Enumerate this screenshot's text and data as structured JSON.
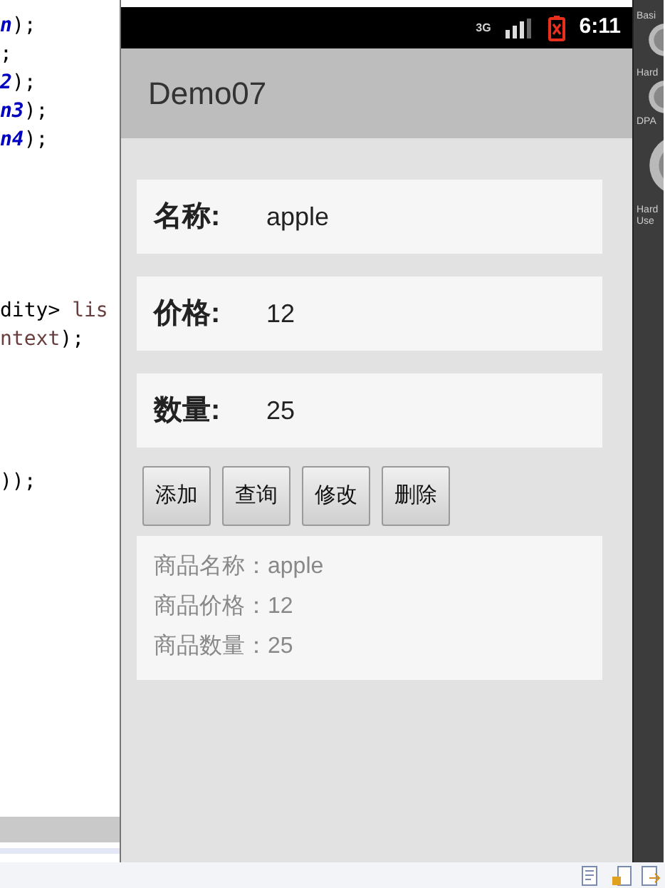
{
  "editor": {
    "lines": [
      {
        "parts": [
          {
            "text": "n",
            "kind": "field"
          },
          {
            "text": ");",
            "kind": "plain"
          }
        ]
      },
      {
        "parts": [
          {
            "text": ";",
            "kind": "plain"
          }
        ]
      },
      {
        "parts": [
          {
            "text": "2",
            "kind": "field"
          },
          {
            "text": ");",
            "kind": "plain"
          }
        ]
      },
      {
        "parts": [
          {
            "text": "n3",
            "kind": "field"
          },
          {
            "text": ");",
            "kind": "plain"
          }
        ]
      },
      {
        "parts": [
          {
            "text": "n4",
            "kind": "field"
          },
          {
            "text": ");",
            "kind": "plain"
          }
        ]
      },
      {
        "parts": [
          {
            "text": "dity> ",
            "kind": "plain"
          },
          {
            "text": "lis",
            "kind": "variable"
          }
        ]
      },
      {
        "parts": [
          {
            "text": "ntext",
            "kind": "variable"
          },
          {
            "text": ");",
            "kind": "plain"
          }
        ]
      },
      {
        "parts": [
          {
            "text": "));",
            "kind": "plain"
          }
        ]
      }
    ]
  },
  "phone": {
    "status_bar": {
      "network": "3G",
      "time": "6:11"
    },
    "app_title": "Demo07",
    "fields": [
      {
        "label": "名称:",
        "value": "apple"
      },
      {
        "label": "价格:",
        "value": "12"
      },
      {
        "label": "数量:",
        "value": "25"
      }
    ],
    "buttons": [
      "添加",
      "查询",
      "修改",
      "删除"
    ],
    "result_lines": [
      "商品名称：apple",
      "商品价格：12",
      "商品数量：25"
    ]
  },
  "side_panel": {
    "labels": [
      {
        "text": "Basi"
      },
      {
        "text": "Hard"
      },
      {
        "text": "DPA"
      },
      {
        "text": "Hard"
      },
      {
        "text": "Use"
      }
    ]
  }
}
